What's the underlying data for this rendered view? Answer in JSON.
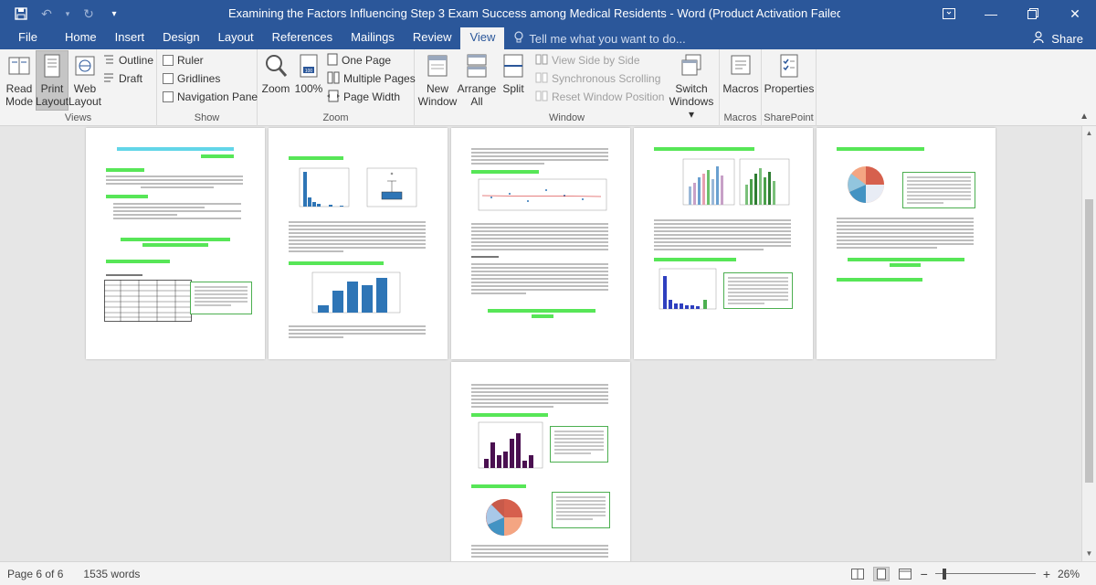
{
  "titlebar": {
    "title": "Examining the Factors Influencing Step 3 Exam Success among Medical Residents - Word (Product Activation Failed)",
    "save_icon": "save-icon",
    "undo_icon": "undo-icon",
    "redo_icon": "redo-icon",
    "customize_icon": "chevron-down-icon"
  },
  "tabs": [
    "File",
    "Home",
    "Insert",
    "Design",
    "Layout",
    "References",
    "Mailings",
    "Review",
    "View"
  ],
  "active_tab": "View",
  "tellme": "Tell me what you want to do...",
  "share": "Share",
  "ribbon": {
    "views": {
      "label": "Views",
      "read_mode": [
        "Read",
        "Mode"
      ],
      "print_layout": [
        "Print",
        "Layout"
      ],
      "web_layout": [
        "Web",
        "Layout"
      ],
      "outline": "Outline",
      "draft": "Draft"
    },
    "show": {
      "label": "Show",
      "ruler": "Ruler",
      "gridlines": "Gridlines",
      "navigation_pane": "Navigation Pane"
    },
    "zoom": {
      "label": "Zoom",
      "zoom": "Zoom",
      "hundred": "100%",
      "one_page": "One Page",
      "multiple_pages": "Multiple Pages",
      "page_width": "Page Width"
    },
    "window": {
      "label": "Window",
      "new_window": [
        "New",
        "Window"
      ],
      "arrange_all": [
        "Arrange",
        "All"
      ],
      "split": "Split",
      "view_side_by_side": "View Side by Side",
      "sync_scrolling": "Synchronous Scrolling",
      "reset_position": "Reset Window Position",
      "switch_windows": [
        "Switch",
        "Windows ▾"
      ]
    },
    "macros": {
      "label": "Macros",
      "button": "Macros"
    },
    "sharepoint": {
      "label": "SharePoint",
      "button": "Properties"
    }
  },
  "status": {
    "page": "Page 6 of 6",
    "words": "1535 words",
    "zoom": "26%",
    "zoom_fraction": 0.26
  },
  "colors": {
    "brand": "#2b579a",
    "highlight_green": "#57e657",
    "highlight_cyan": "#22d3ee",
    "chart_blue": "#2e75b6",
    "chart_purple": "#4a1050"
  }
}
